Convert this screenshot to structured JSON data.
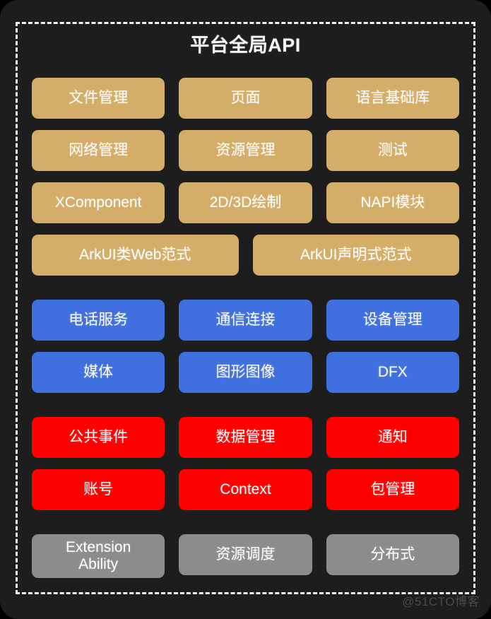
{
  "header": {
    "title": "平台全局API"
  },
  "watermark": "@51CTO博客",
  "colors": {
    "page_background": "#000000",
    "card_background": "#1d1d1d",
    "frame_border": "#f2f2f2",
    "gold": "#d4ad68",
    "blue": "#4070e0",
    "red": "#fd0000",
    "gray": "#8c8c8c",
    "text": "#ffffff",
    "watermark": "#4a4a4a"
  },
  "sections": [
    {
      "name": "gold-group",
      "color_key": "gold",
      "rows": [
        {
          "cells": [
            {
              "label": "文件管理"
            },
            {
              "label": "页面"
            },
            {
              "label": "语言基础库"
            }
          ]
        },
        {
          "cells": [
            {
              "label": "网络管理"
            },
            {
              "label": "资源管理"
            },
            {
              "label": "测试"
            }
          ]
        },
        {
          "cells": [
            {
              "label": "XComponent"
            },
            {
              "label": "2D/3D绘制"
            },
            {
              "label": "NAPI模块"
            }
          ]
        },
        {
          "cells": [
            {
              "label": "ArkUI类Web范式"
            },
            {
              "label": "ArkUI声明式范式"
            }
          ]
        }
      ]
    },
    {
      "name": "blue-group",
      "color_key": "blue",
      "rows": [
        {
          "cells": [
            {
              "label": "电话服务"
            },
            {
              "label": "通信连接"
            },
            {
              "label": "设备管理"
            }
          ]
        },
        {
          "cells": [
            {
              "label": "媒体"
            },
            {
              "label": "图形图像"
            },
            {
              "label": "DFX"
            }
          ]
        }
      ]
    },
    {
      "name": "red-group",
      "color_key": "red",
      "rows": [
        {
          "cells": [
            {
              "label": "公共事件"
            },
            {
              "label": "数据管理"
            },
            {
              "label": "通知"
            }
          ]
        },
        {
          "cells": [
            {
              "label": "账号"
            },
            {
              "label": "Context"
            },
            {
              "label": "包管理"
            }
          ]
        }
      ]
    },
    {
      "name": "gray-group",
      "color_key": "gray",
      "rows": [
        {
          "cells": [
            {
              "label": "Extension\nAbility"
            },
            {
              "label": "资源调度"
            },
            {
              "label": "分布式"
            }
          ]
        }
      ]
    }
  ]
}
